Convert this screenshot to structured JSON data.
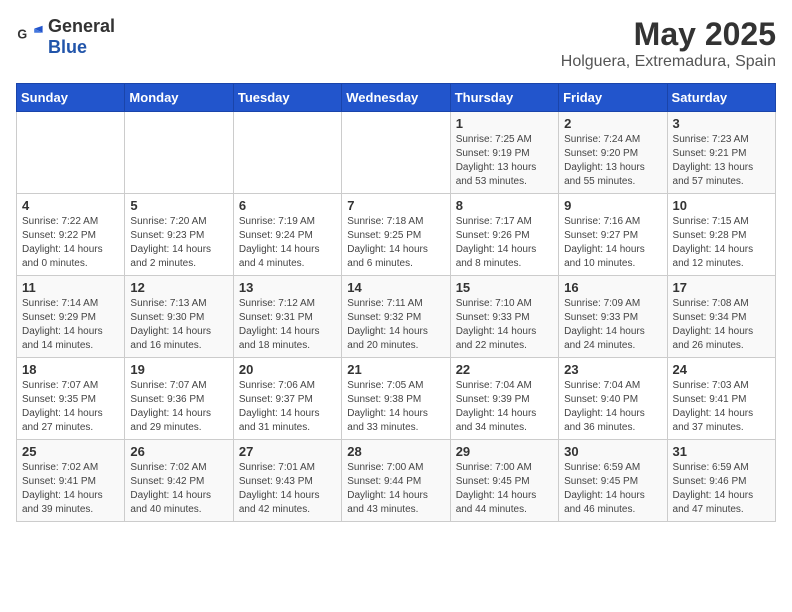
{
  "header": {
    "logo_general": "General",
    "logo_blue": "Blue",
    "title": "May 2025",
    "subtitle": "Holguera, Extremadura, Spain"
  },
  "days_of_week": [
    "Sunday",
    "Monday",
    "Tuesday",
    "Wednesday",
    "Thursday",
    "Friday",
    "Saturday"
  ],
  "weeks": [
    [
      {
        "day": "",
        "info": ""
      },
      {
        "day": "",
        "info": ""
      },
      {
        "day": "",
        "info": ""
      },
      {
        "day": "",
        "info": ""
      },
      {
        "day": "1",
        "info": "Sunrise: 7:25 AM\nSunset: 9:19 PM\nDaylight: 13 hours\nand 53 minutes."
      },
      {
        "day": "2",
        "info": "Sunrise: 7:24 AM\nSunset: 9:20 PM\nDaylight: 13 hours\nand 55 minutes."
      },
      {
        "day": "3",
        "info": "Sunrise: 7:23 AM\nSunset: 9:21 PM\nDaylight: 13 hours\nand 57 minutes."
      }
    ],
    [
      {
        "day": "4",
        "info": "Sunrise: 7:22 AM\nSunset: 9:22 PM\nDaylight: 14 hours\nand 0 minutes."
      },
      {
        "day": "5",
        "info": "Sunrise: 7:20 AM\nSunset: 9:23 PM\nDaylight: 14 hours\nand 2 minutes."
      },
      {
        "day": "6",
        "info": "Sunrise: 7:19 AM\nSunset: 9:24 PM\nDaylight: 14 hours\nand 4 minutes."
      },
      {
        "day": "7",
        "info": "Sunrise: 7:18 AM\nSunset: 9:25 PM\nDaylight: 14 hours\nand 6 minutes."
      },
      {
        "day": "8",
        "info": "Sunrise: 7:17 AM\nSunset: 9:26 PM\nDaylight: 14 hours\nand 8 minutes."
      },
      {
        "day": "9",
        "info": "Sunrise: 7:16 AM\nSunset: 9:27 PM\nDaylight: 14 hours\nand 10 minutes."
      },
      {
        "day": "10",
        "info": "Sunrise: 7:15 AM\nSunset: 9:28 PM\nDaylight: 14 hours\nand 12 minutes."
      }
    ],
    [
      {
        "day": "11",
        "info": "Sunrise: 7:14 AM\nSunset: 9:29 PM\nDaylight: 14 hours\nand 14 minutes."
      },
      {
        "day": "12",
        "info": "Sunrise: 7:13 AM\nSunset: 9:30 PM\nDaylight: 14 hours\nand 16 minutes."
      },
      {
        "day": "13",
        "info": "Sunrise: 7:12 AM\nSunset: 9:31 PM\nDaylight: 14 hours\nand 18 minutes."
      },
      {
        "day": "14",
        "info": "Sunrise: 7:11 AM\nSunset: 9:32 PM\nDaylight: 14 hours\nand 20 minutes."
      },
      {
        "day": "15",
        "info": "Sunrise: 7:10 AM\nSunset: 9:33 PM\nDaylight: 14 hours\nand 22 minutes."
      },
      {
        "day": "16",
        "info": "Sunrise: 7:09 AM\nSunset: 9:33 PM\nDaylight: 14 hours\nand 24 minutes."
      },
      {
        "day": "17",
        "info": "Sunrise: 7:08 AM\nSunset: 9:34 PM\nDaylight: 14 hours\nand 26 minutes."
      }
    ],
    [
      {
        "day": "18",
        "info": "Sunrise: 7:07 AM\nSunset: 9:35 PM\nDaylight: 14 hours\nand 27 minutes."
      },
      {
        "day": "19",
        "info": "Sunrise: 7:07 AM\nSunset: 9:36 PM\nDaylight: 14 hours\nand 29 minutes."
      },
      {
        "day": "20",
        "info": "Sunrise: 7:06 AM\nSunset: 9:37 PM\nDaylight: 14 hours\nand 31 minutes."
      },
      {
        "day": "21",
        "info": "Sunrise: 7:05 AM\nSunset: 9:38 PM\nDaylight: 14 hours\nand 33 minutes."
      },
      {
        "day": "22",
        "info": "Sunrise: 7:04 AM\nSunset: 9:39 PM\nDaylight: 14 hours\nand 34 minutes."
      },
      {
        "day": "23",
        "info": "Sunrise: 7:04 AM\nSunset: 9:40 PM\nDaylight: 14 hours\nand 36 minutes."
      },
      {
        "day": "24",
        "info": "Sunrise: 7:03 AM\nSunset: 9:41 PM\nDaylight: 14 hours\nand 37 minutes."
      }
    ],
    [
      {
        "day": "25",
        "info": "Sunrise: 7:02 AM\nSunset: 9:41 PM\nDaylight: 14 hours\nand 39 minutes."
      },
      {
        "day": "26",
        "info": "Sunrise: 7:02 AM\nSunset: 9:42 PM\nDaylight: 14 hours\nand 40 minutes."
      },
      {
        "day": "27",
        "info": "Sunrise: 7:01 AM\nSunset: 9:43 PM\nDaylight: 14 hours\nand 42 minutes."
      },
      {
        "day": "28",
        "info": "Sunrise: 7:00 AM\nSunset: 9:44 PM\nDaylight: 14 hours\nand 43 minutes."
      },
      {
        "day": "29",
        "info": "Sunrise: 7:00 AM\nSunset: 9:45 PM\nDaylight: 14 hours\nand 44 minutes."
      },
      {
        "day": "30",
        "info": "Sunrise: 6:59 AM\nSunset: 9:45 PM\nDaylight: 14 hours\nand 46 minutes."
      },
      {
        "day": "31",
        "info": "Sunrise: 6:59 AM\nSunset: 9:46 PM\nDaylight: 14 hours\nand 47 minutes."
      }
    ]
  ]
}
